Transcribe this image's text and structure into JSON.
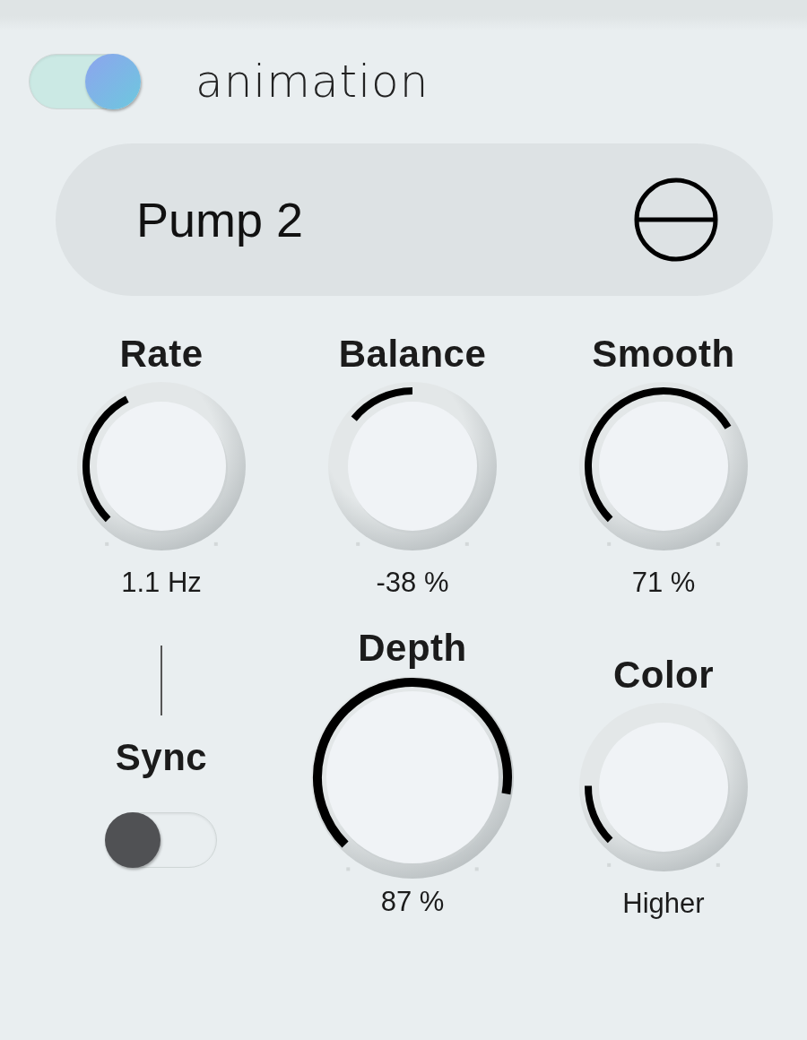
{
  "animation_toggle": {
    "label": "animation",
    "on": true
  },
  "preset": {
    "name": "Pump 2"
  },
  "knobs": [
    {
      "label": "Rate",
      "kind": "standard",
      "reading": "1.1 Hz"
    },
    {
      "label": "Balance",
      "kind": "standard",
      "reading": "-38 %"
    },
    {
      "label": "Smooth",
      "kind": "standard",
      "reading": "71 %"
    },
    {
      "label": "Depth",
      "kind": "large",
      "reading": "87 %"
    },
    {
      "label": "Color",
      "kind": "standard",
      "reading": "Higher"
    }
  ],
  "sync": {
    "label": "Sync",
    "on": false
  }
}
